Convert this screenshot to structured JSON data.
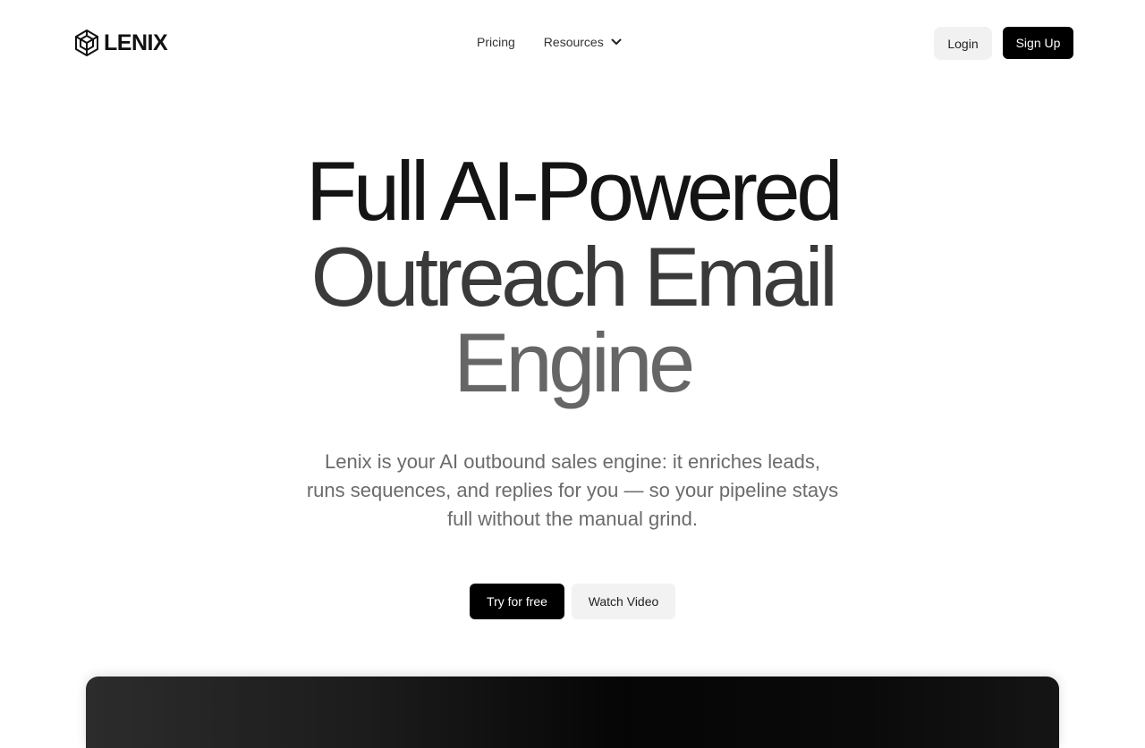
{
  "brand": {
    "name": "LENIX",
    "logo_icon": "hexagon-knot-icon"
  },
  "nav": {
    "links": [
      {
        "label": "Pricing"
      },
      {
        "label": "Resources",
        "icon": "chevron-down-icon"
      }
    ],
    "login_label": "Login",
    "signup_label": "Sign Up"
  },
  "hero": {
    "title_line1": "Full AI-Powered",
    "title_line2": "Outreach Email",
    "title_line3": "Engine",
    "subtitle": "Lenix is your AI outbound sales engine: it enriches leads, runs sequences, and replies for you — so your pipeline stays full without the manual grind.",
    "primary_cta": "Try for free",
    "secondary_cta": "Watch Video"
  },
  "colors": {
    "primary": "#000000",
    "secondary_button": "#f2f2f2",
    "title_dark": "#141414",
    "title_mid": "#3a3a3a",
    "title_light": "#666666"
  }
}
